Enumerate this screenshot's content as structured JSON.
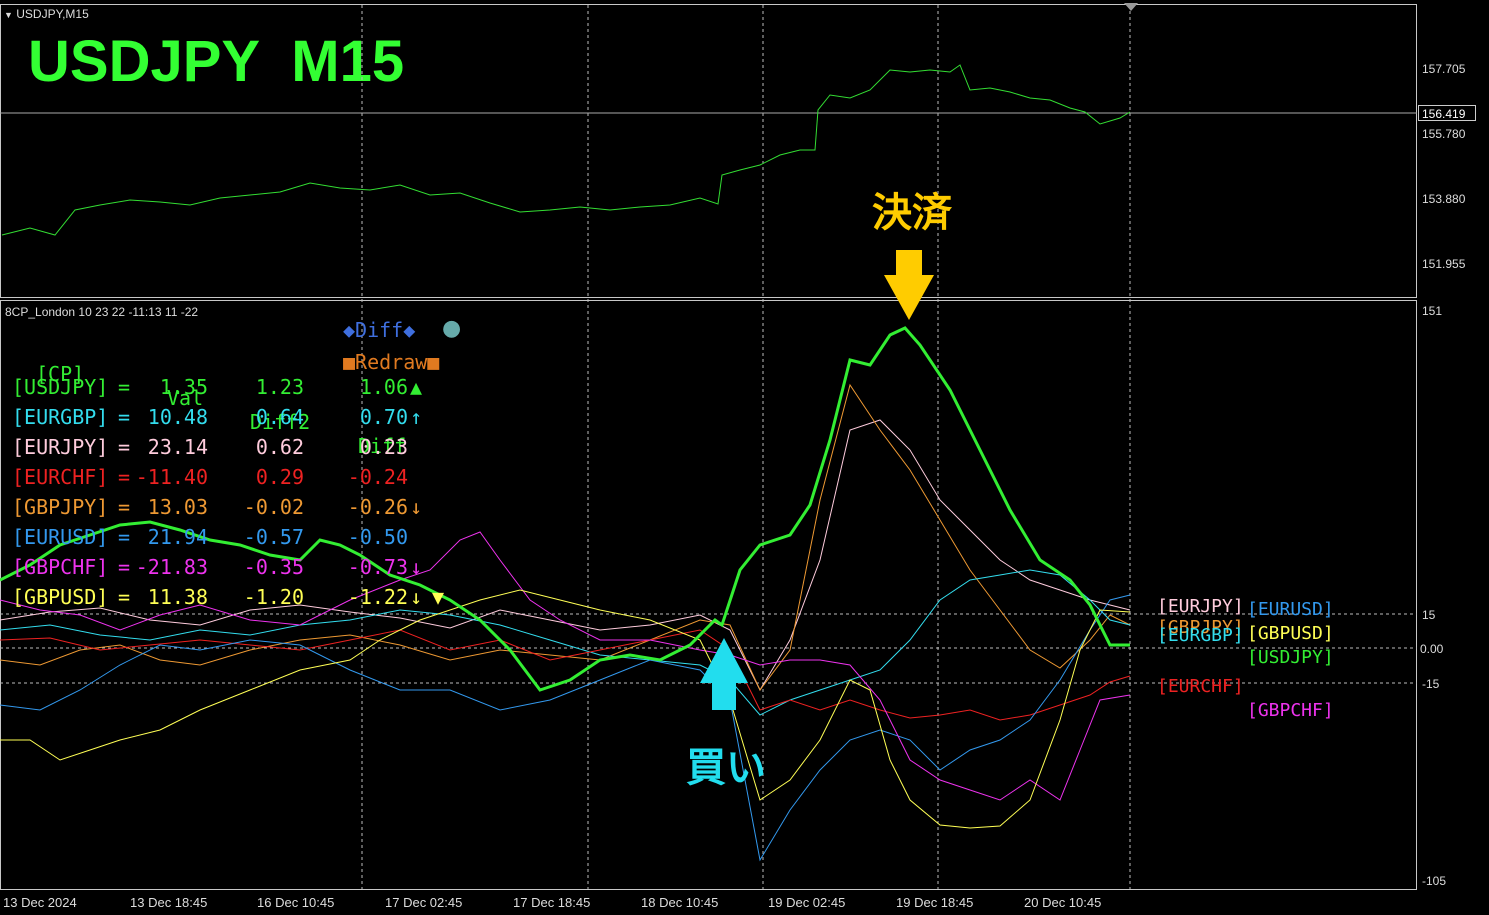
{
  "window": {
    "symbol_tab": "USDJPY,M15"
  },
  "main_title": "USDJPY  M15",
  "main_title_color": "#33ff33",
  "price_axis": {
    "ticks": [
      "157.705",
      "155.780",
      "153.880",
      "151.955"
    ],
    "current_price": "156.419"
  },
  "indicator": {
    "name": "8CP_London 10 23 22 -11:13 11 -22",
    "axis_ticks": [
      "151",
      "15",
      "0.00",
      "-15",
      "-105"
    ],
    "legend": {
      "diff": "◆Diff◆",
      "diff_dot": "●",
      "redraw": "■Redraw■",
      "diff_color": "#3f6fdf",
      "redraw_color": "#e07a20"
    },
    "header": {
      "cp": "[CP]",
      "val": "Val",
      "diff2": "Diff2",
      "diff": "Diff"
    },
    "rows": [
      {
        "pair": "[USDJPY]",
        "val": "1.35",
        "diff2": "1.23",
        "diff": "1.06",
        "mark": "▲",
        "color": "#33ee33",
        "mark_color": "#33ee33"
      },
      {
        "pair": "[EURGBP]",
        "val": "10.48",
        "diff2": "0.64",
        "diff": "0.70",
        "mark": "↑",
        "color": "#33ddee",
        "mark_color": "#33ddee"
      },
      {
        "pair": "[EURJPY]",
        "val": "23.14",
        "diff2": "0.62",
        "diff": "0.23",
        "mark": "",
        "color": "#ffccdd",
        "mark_color": "#ffccdd"
      },
      {
        "pair": "[EURCHF]",
        "val": "-11.40",
        "diff2": "0.29",
        "diff": "-0.24",
        "mark": "",
        "color": "#ee2222",
        "mark_color": "#ee2222"
      },
      {
        "pair": "[GBPJPY]",
        "val": "13.03",
        "diff2": "-0.02",
        "diff": "-0.26",
        "mark": "↓",
        "color": "#ee9933",
        "mark_color": "#ee9933"
      },
      {
        "pair": "[EURUSD]",
        "val": "21.94",
        "diff2": "-0.57",
        "diff": "-0.50",
        "mark": "",
        "color": "#3399ee",
        "mark_color": "#3399ee"
      },
      {
        "pair": "[GBPCHF]",
        "val": "-21.83",
        "diff2": "-0.35",
        "diff": "-0.73",
        "mark": "↓",
        "color": "#ee33ee",
        "mark_color": "#ee33ee"
      },
      {
        "pair": "[GBPUSD]",
        "val": "11.38",
        "diff2": "-1.20",
        "diff": "-1.22",
        "mark": "↓",
        "color": "#ffff55",
        "mark_color": "#ffff55",
        "extra_mark": "▼"
      }
    ],
    "end_labels": [
      {
        "text": "[EURJPY]",
        "color": "#ffccdd"
      },
      {
        "text": "[EURUSD]",
        "color": "#3399ee"
      },
      {
        "text": "[GBPJPY]",
        "color": "#ee9933"
      },
      {
        "text": "[EURGBP]",
        "color": "#33ddee"
      },
      {
        "text": "[GBPUSD]",
        "color": "#ffff55"
      },
      {
        "text": "[USDJPY]",
        "color": "#33ee33"
      },
      {
        "text": "[EURCHF]",
        "color": "#ee2222"
      },
      {
        "text": "[GBPCHF]",
        "color": "#ee33ee"
      }
    ]
  },
  "annotations": {
    "settle": {
      "text": "決済",
      "color": "#ffcc00"
    },
    "buy": {
      "text": "買い",
      "color": "#22ddee"
    }
  },
  "time_axis": [
    "13 Dec 2024",
    "13 Dec 18:45",
    "16 Dec 10:45",
    "17 Dec 02:45",
    "17 Dec 18:45",
    "18 Dec 10:45",
    "19 Dec 02:45",
    "19 Dec 18:45",
    "20 Dec 10:45"
  ]
}
